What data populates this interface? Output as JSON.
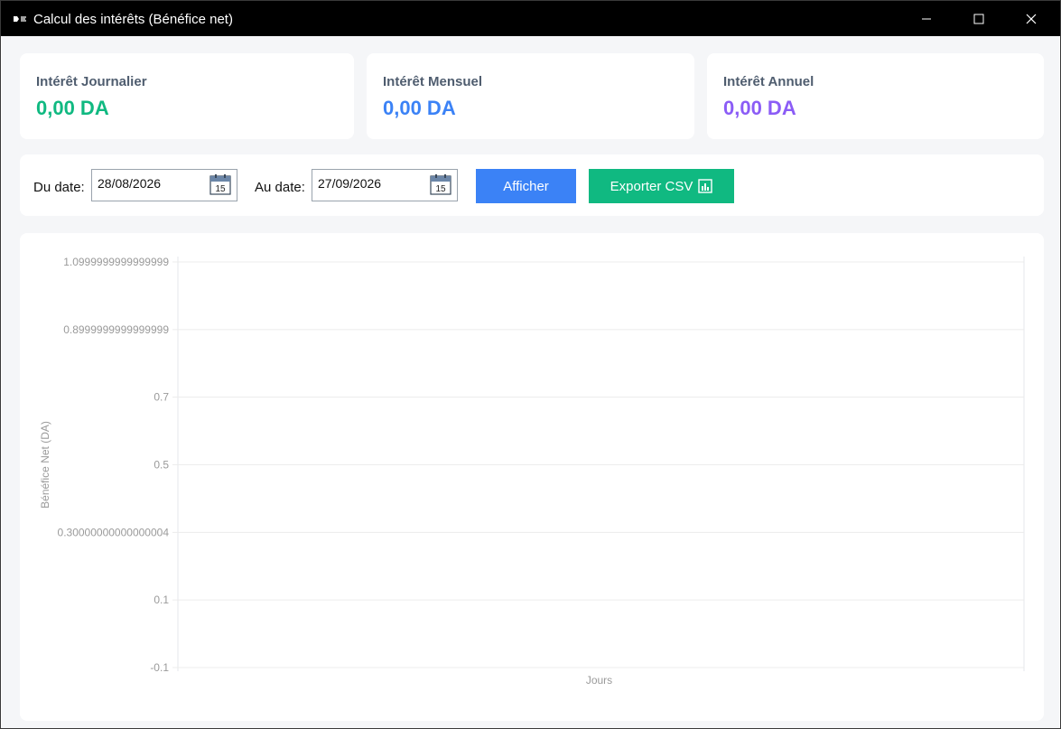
{
  "window": {
    "title": "Calcul des intérêts (Bénéfice net)",
    "controls": {
      "minimize": "–",
      "maximize": "□",
      "close": "✕"
    }
  },
  "stats": [
    {
      "label": "Intérêt Journalier",
      "value": "0,00 DA",
      "color": "#10b981"
    },
    {
      "label": "Intérêt Mensuel",
      "value": "0,00 DA",
      "color": "#3b82f6"
    },
    {
      "label": "Intérêt Annuel",
      "value": "0,00 DA",
      "color": "#8b5cf6"
    }
  ],
  "filters": {
    "from_label": "Du date:",
    "from_value": "28/08/2026",
    "to_label": "Au date:",
    "to_value": "27/09/2026",
    "calendar_day": "15",
    "show_button": "Afficher",
    "export_button": "Exporter CSV"
  },
  "chart_data": {
    "type": "line",
    "title": "",
    "xlabel": "Jours",
    "ylabel": "Bénéfice Net (DA)",
    "ylim": [
      -0.1,
      1.0999999999999999
    ],
    "yticks": [
      "1.0999999999999999",
      "0.8999999999999999",
      "0.7",
      "0.5",
      "0.30000000000000004",
      "0.1",
      "-0.1"
    ],
    "categories": [],
    "series": [],
    "grid": true
  },
  "colors": {
    "accent_blue": "#3b82f6",
    "accent_green": "#10b981",
    "accent_purple": "#8b5cf6"
  }
}
